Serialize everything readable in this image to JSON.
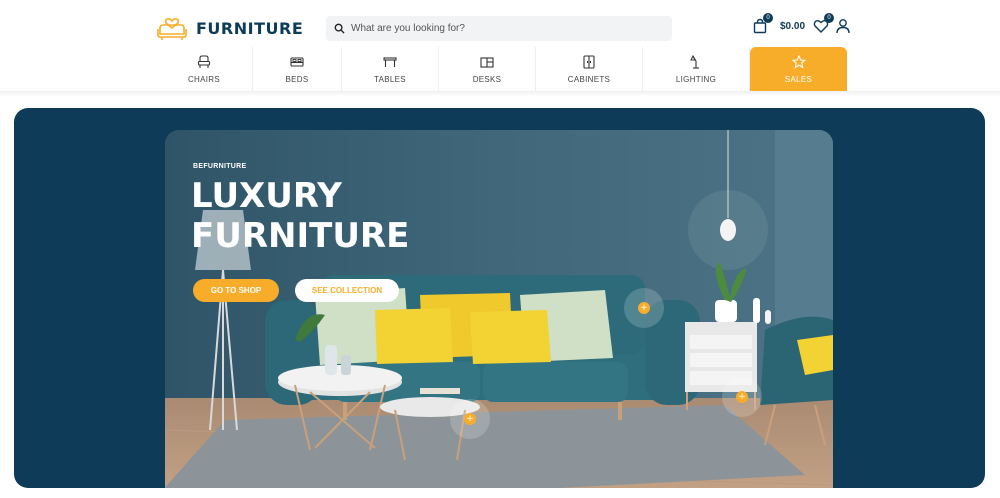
{
  "brand": {
    "logo_text": "FURNITURE",
    "logo_icon": "sofa-heart-logo",
    "accent_color": "#f8ad2a",
    "primary_color": "#0e3b57"
  },
  "search": {
    "placeholder": "What are you looking for?",
    "value": ""
  },
  "cart": {
    "count": "0",
    "total": "$0.00"
  },
  "wishlist": {
    "count": "0"
  },
  "nav": {
    "items": [
      {
        "label": "CHAIRS",
        "icon": "chair-icon"
      },
      {
        "label": "BEDS",
        "icon": "bed-icon"
      },
      {
        "label": "TABLES",
        "icon": "table-icon"
      },
      {
        "label": "DESKS",
        "icon": "desk-icon"
      },
      {
        "label": "CABINETS",
        "icon": "cabinet-icon"
      },
      {
        "label": "LIGHTING",
        "icon": "lamp-icon"
      },
      {
        "label": "SALES",
        "icon": "star-icon"
      }
    ]
  },
  "hero": {
    "eyebrow": "BEFURNITURE",
    "headline": "LUXURY FURNITURE",
    "primary_button": "GO TO SHOP",
    "secondary_button": "SEE COLLECTION",
    "hotspot_symbol": "+"
  }
}
